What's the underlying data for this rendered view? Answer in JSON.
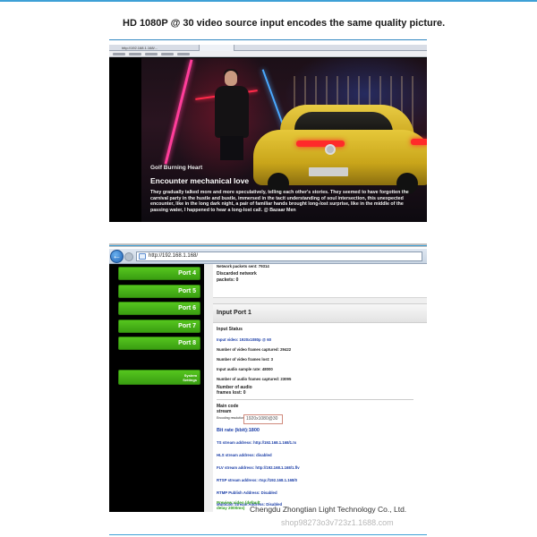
{
  "headline": "HD 1080P @ 30 video source input encodes the same quality picture.",
  "screenshot1": {
    "address_text": "http://192.168.1.168/...",
    "overlay": {
      "subtitle": "Golf Burning Heart",
      "title": "Encounter mechanical love",
      "body": "They gradually talked more and more speculatively, telling each other's stories. They seemed to have forgotten the carnival party in the hustle and bustle, immersed in the tacit understanding of soul intersection, this unexpected encounter, like in the long dark night, a pair of familiar hands brought long-lost surprise, like in the middle of the passing water, I happened to hear a long-lost call. @ Bazaar Men"
    }
  },
  "screenshot2": {
    "browser": {
      "back_glyph": "←",
      "url": "http://192.168.1.168/"
    },
    "sidebar": {
      "ports": [
        "Port 4",
        "Port 5",
        "Port 6",
        "Port 7",
        "Port 8"
      ],
      "system_settings_line1": "System",
      "system_settings_line2": "Settings"
    },
    "top_card": {
      "network_packets_sent": "Network packets sent: 79314",
      "discarded_line1": "Discarded network",
      "discarded_line2": "packets: 0"
    },
    "section_title": "Input Port 1",
    "input_status": {
      "heading": "Input Status",
      "input_video": "Input video: 1920x1080p @ 60",
      "frames_captured": "Number of video frames captured: 29422",
      "frames_lost": "Number of video frames lost: 3",
      "audio_sample_rate": "Input audio sample rate: 48000",
      "audio_frames_captured": "Number of audio frames captured: 23095",
      "audio_lost_line1": "Number of audio",
      "audio_lost_line2": "frames lost: 0"
    },
    "main_stream": {
      "heading_line1": "Main code",
      "heading_line2": "stream",
      "encoding_label": "Encoding resolution",
      "resolution_value": "1920x1080@30",
      "bitrate": "Bit rate (kbit):1800",
      "ts_address": "TS stream address: http://192.168.1.168/1.ts",
      "hls_address": "HLS stream address: disabled",
      "flv_address": "FLV stream address: http://192.168.1.168/1.flv",
      "rtsp_address": "RTSP stream address: rtsp://192.168.1.168/0",
      "rtmp_address": "RTMP Publish Address: Disabled",
      "multicast_address": "Multicast Stream Address: Disabled",
      "preview_line1": "Preview video (default",
      "preview_line2": "delay 2000ms)"
    }
  },
  "footer": {
    "company": "Chengdu Zhongtian Light Technology Co., Ltd.",
    "watermark": "shop98273o3v723z1.1688.com"
  }
}
